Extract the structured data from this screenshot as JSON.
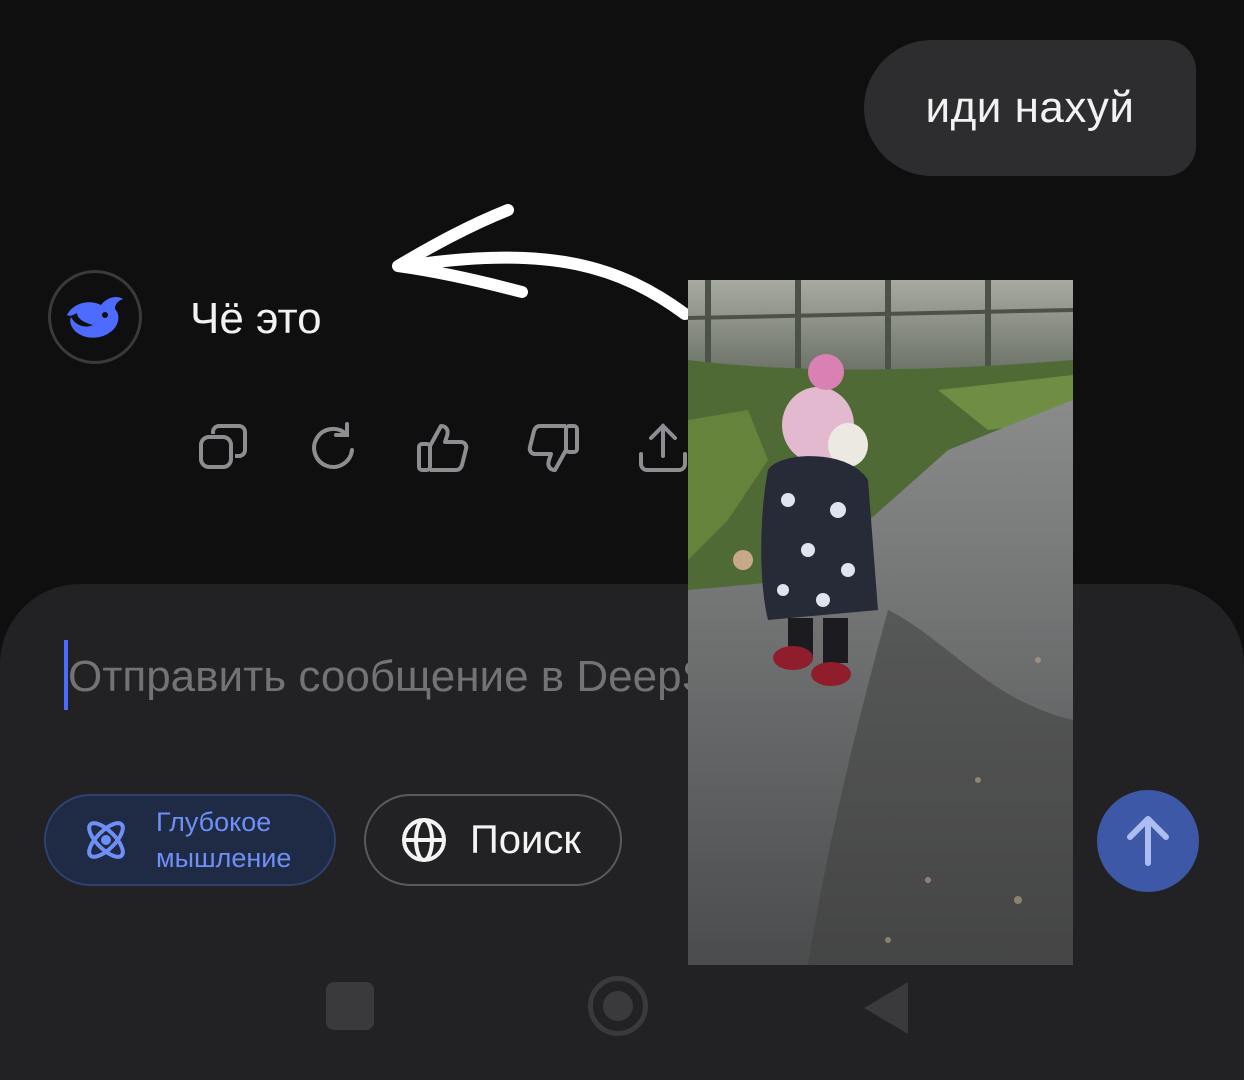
{
  "chat": {
    "user_message": "иди нахуй",
    "assistant_reply": "Чё это"
  },
  "reply_actions": [
    "copy-icon",
    "regenerate-icon",
    "thumbs-up-icon",
    "thumbs-down-icon",
    "share-icon"
  ],
  "composer": {
    "placeholder": "Отправить сообщение в DeepSeek",
    "deep_thinking_label": "Глубокое\nмышление",
    "search_label": "Поиск"
  },
  "colors": {
    "accent": "#4d6bfe",
    "background": "#0f0f10",
    "composer": "#222224",
    "bubble": "#2d2d2f"
  }
}
